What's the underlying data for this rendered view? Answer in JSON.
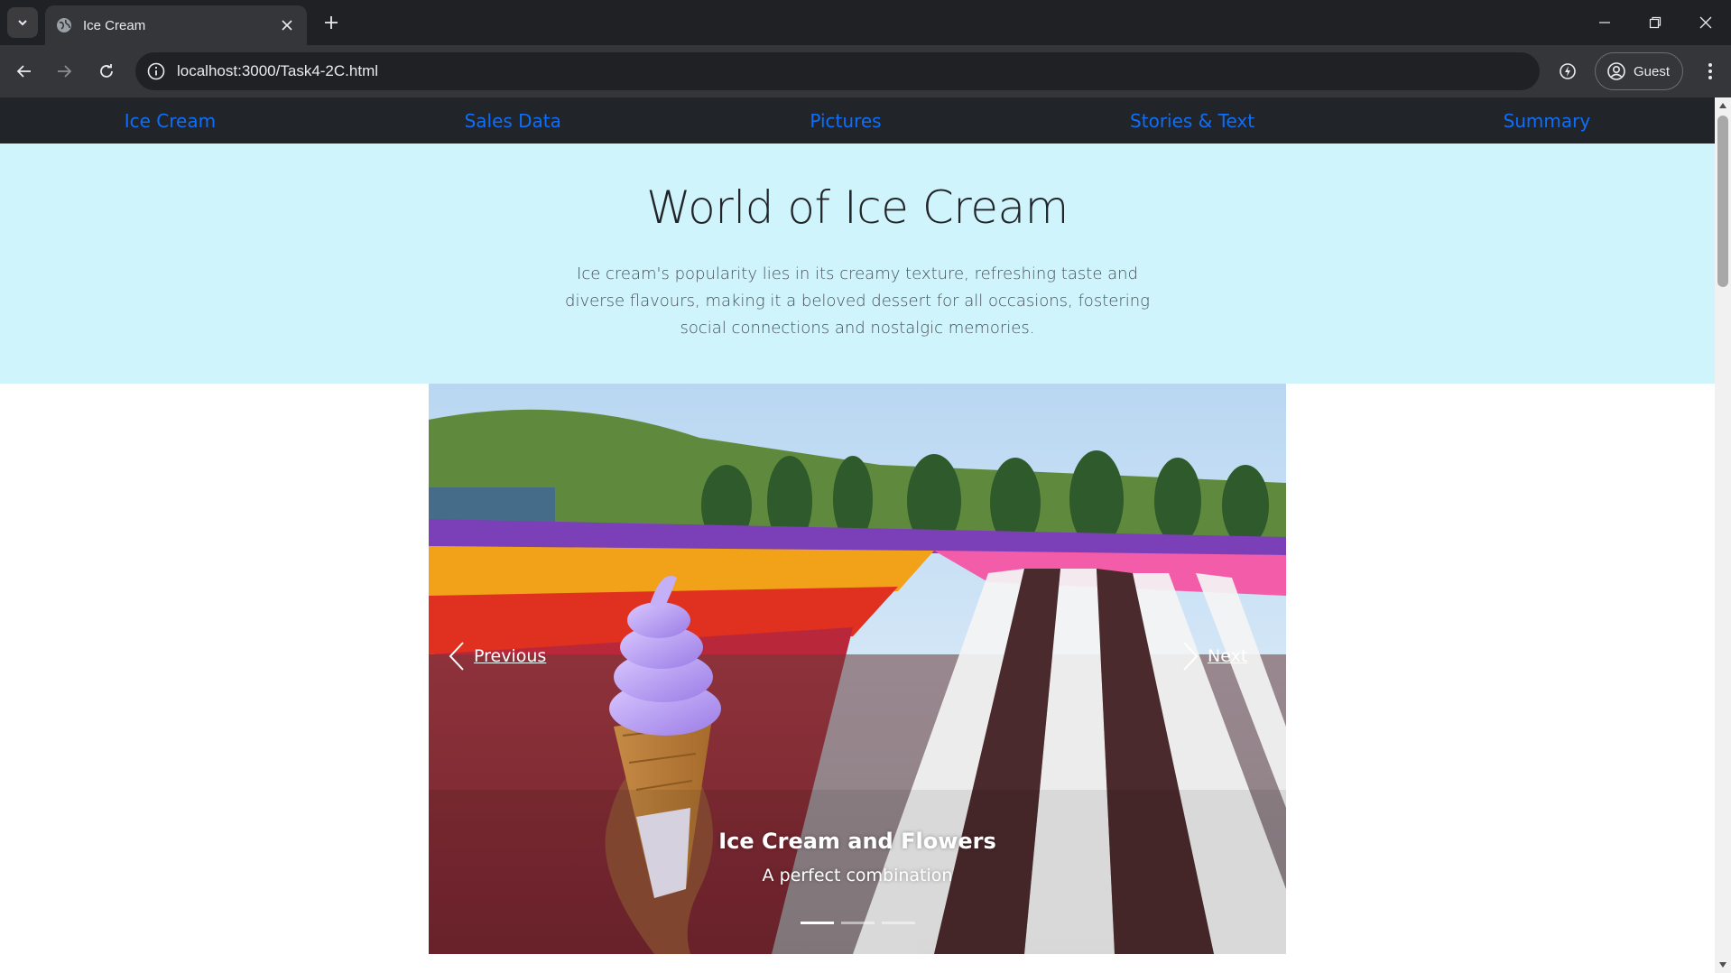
{
  "browser": {
    "tab_title": "Ice Cream",
    "url": "localhost:3000/Task4-2C.html",
    "profile_label": "Guest",
    "icons": {
      "tab_search": "chevron-down-icon",
      "favicon": "globe-icon",
      "tab_close": "close-icon",
      "new_tab": "plus-icon",
      "minimize": "minimize-icon",
      "restore": "restore-icon",
      "close_window": "close-icon",
      "back": "arrow-left-icon",
      "forward": "arrow-right-icon",
      "reload": "reload-icon",
      "site_info": "info-icon",
      "performance": "performance-icon",
      "profile": "profile-icon",
      "menu": "kebab-menu-icon"
    }
  },
  "nav": {
    "items": [
      {
        "label": "Ice Cream"
      },
      {
        "label": "Sales Data"
      },
      {
        "label": "Pictures"
      },
      {
        "label": "Stories & Text"
      },
      {
        "label": "Summary"
      }
    ]
  },
  "hero": {
    "title": "World of Ice Cream",
    "description": "Ice cream's popularity lies in its creamy texture, refreshing taste and diverse flavours, making it a beloved dessert for all occasions, fostering social connections and nostalgic memories."
  },
  "carousel": {
    "prev_label": "Previous",
    "next_label": "Next",
    "caption_title": "Ice Cream and Flowers",
    "caption_text": "A perfect combination",
    "slide_count": 3,
    "active_slide": 1
  },
  "colors": {
    "nav_bg": "#212529",
    "nav_link": "#0d6efd",
    "hero_bg": "#cff4fc",
    "chrome_dark": "#202124",
    "chrome_toolbar": "#35363a"
  }
}
